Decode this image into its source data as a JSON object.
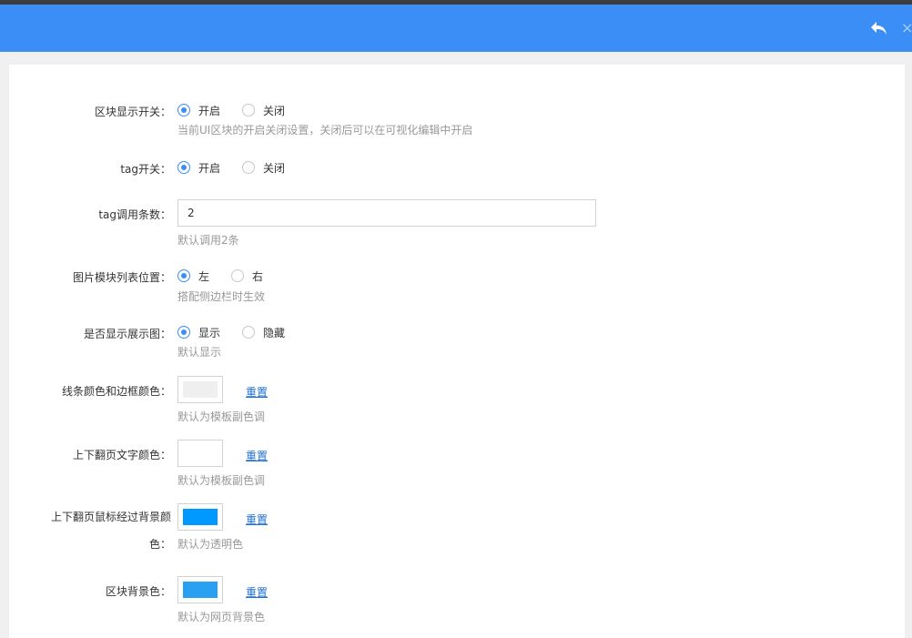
{
  "header": {
    "back_icon": "undo-arrow-icon",
    "close_icon": "close-icon",
    "close_glyph": "×",
    "bg_color": "#3a8ef6"
  },
  "form": {
    "block_switch": {
      "label": "区块显示开关：",
      "options": [
        "开启",
        "关闭"
      ],
      "selected": "开启",
      "hint": "当前UI区块的开启关闭设置，关闭后可以在可视化编辑中开启"
    },
    "tag_switch": {
      "label": "tag开关：",
      "options": [
        "开启",
        "关闭"
      ],
      "selected": "开启"
    },
    "tag_count": {
      "label": "tag调用条数：",
      "value": "2",
      "hint": "默认调用2条"
    },
    "image_position": {
      "label": "图片模块列表位置：",
      "options": [
        "左",
        "右"
      ],
      "selected": "左",
      "hint": "搭配侧边栏时生效"
    },
    "show_image": {
      "label": "是否显示展示图：",
      "options": [
        "显示",
        "隐藏"
      ],
      "selected": "显示",
      "hint": "默认显示"
    },
    "line_color": {
      "label": "线条颜色和边框颜色：",
      "color": "#efefef",
      "reset": "重置",
      "hint": "默认为模板副色调"
    },
    "pager_text_color": {
      "label": "上下翻页文字颜色：",
      "color": "#ffffff",
      "reset": "重置",
      "hint": "默认为模板副色调"
    },
    "pager_hover_bg": {
      "label_line1": "上下翻页鼠标经过背景颜",
      "label_line2": "色：",
      "color": "#0099ff",
      "reset": "重置",
      "hint": "默认为透明色"
    },
    "block_bg": {
      "label": "区块背景色：",
      "color": "#2aa0f2",
      "reset": "重置",
      "hint": "默认为网页背景色"
    }
  }
}
